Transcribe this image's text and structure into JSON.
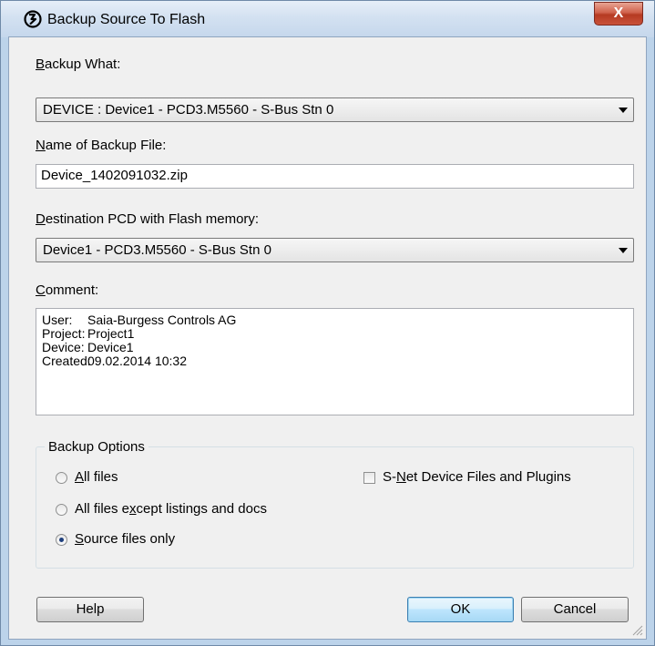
{
  "window": {
    "title": "Backup Source To Flash",
    "close_label": "X"
  },
  "backup_what": {
    "label_mnemonic": "B",
    "label_rest": "ackup What:",
    "value": "DEVICE : Device1 - PCD3.M5560 - S-Bus Stn 0"
  },
  "backup_file": {
    "label_mnemonic": "N",
    "label_rest": "ame of Backup File:",
    "value": "Device_1402091032.zip"
  },
  "destination": {
    "label_mnemonic": "D",
    "label_rest": "estination PCD with Flash memory:",
    "value": "Device1 - PCD3.M5560 - S-Bus Stn 0"
  },
  "comment": {
    "label_mnemonic": "C",
    "label_rest": "omment:",
    "lines": [
      {
        "key": "User:",
        "value": "Saia-Burgess Controls AG"
      },
      {
        "key": "Project:",
        "value": "Project1"
      },
      {
        "key": "Device:",
        "value": "Device1"
      },
      {
        "key": "Created:",
        "value": "09.02.2014 10:32"
      }
    ]
  },
  "options": {
    "title": "Backup Options",
    "all_files": {
      "mnemonic": "A",
      "rest": "ll files",
      "checked": false
    },
    "except_listings": {
      "pre": "All files e",
      "mnemonic": "x",
      "rest": "cept listings and docs",
      "checked": false
    },
    "source_only": {
      "mnemonic": "S",
      "rest": "ource files only",
      "checked": true
    },
    "snet": {
      "pre": "S-",
      "mnemonic": "N",
      "rest": "et Device Files and Plugins",
      "checked": false
    }
  },
  "buttons": {
    "help": "Help",
    "ok": "OK",
    "cancel": "Cancel"
  }
}
